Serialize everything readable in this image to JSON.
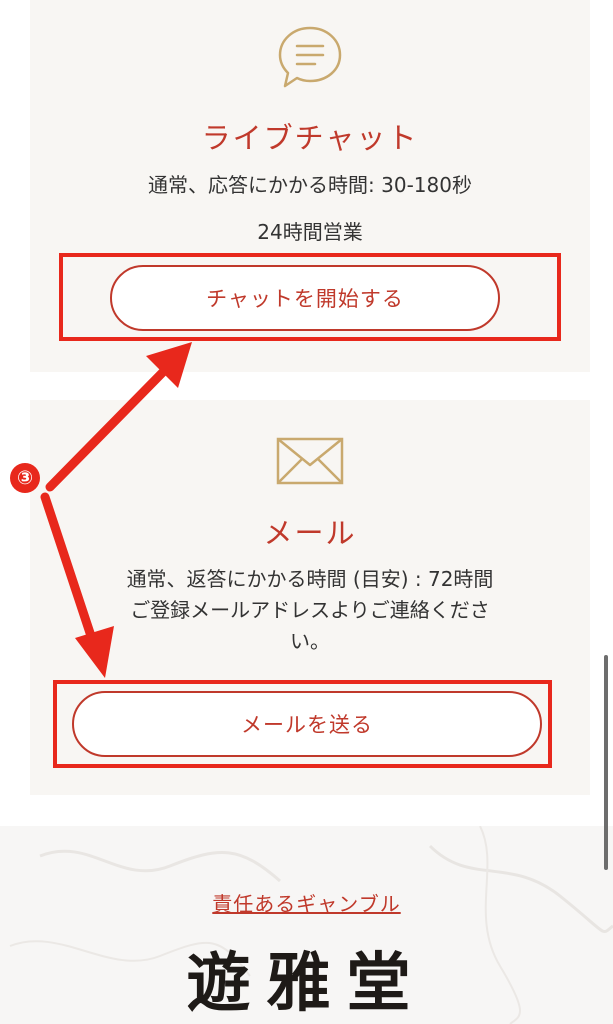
{
  "chat": {
    "icon": "speech-bubble-icon",
    "title": "ライブチャット",
    "response_time": "通常、応答にかかる時間: 30-180秒",
    "hours": "24時間営業",
    "button_label": "チャットを開始する"
  },
  "mail": {
    "icon": "envelope-icon",
    "title": "メール",
    "response_time": "通常、返答にかかる時間 (目安) : 72時間",
    "contact_line1": "ご登録メールアドレスよりご連絡くださ",
    "contact_line2": "い。",
    "button_label": "メールを送る"
  },
  "annotation": {
    "step_number": "③",
    "highlight_color": "#e8281c"
  },
  "footer": {
    "link_label": "責任あるギャンブル",
    "logo_text": "遊雅堂"
  },
  "colors": {
    "accent": "#c0392b",
    "card_background": "#f8f6f3",
    "icon_gold": "#c9a96e"
  }
}
